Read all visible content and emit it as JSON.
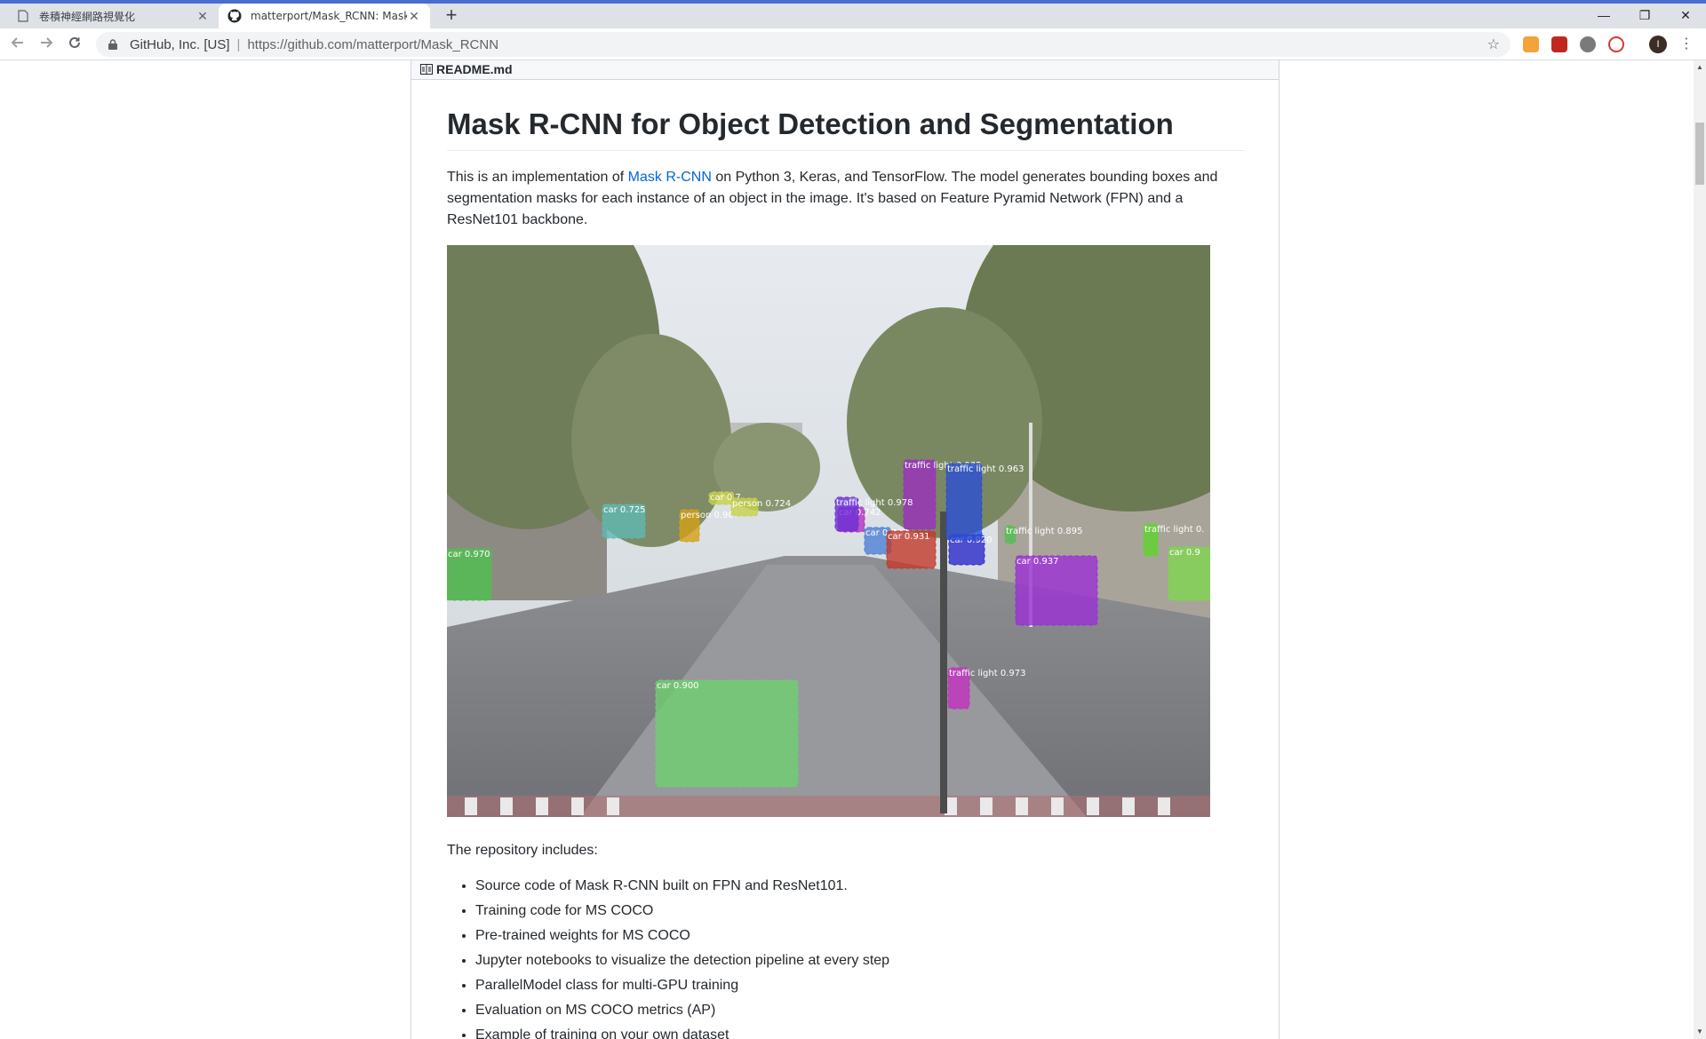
{
  "browser": {
    "tabs": [
      {
        "title": "卷積神經網路視覺化",
        "close": "✕"
      },
      {
        "title": "matterport/Mask_RCNN: Mask",
        "close": "✕"
      }
    ],
    "new_tab": "+",
    "window_controls": {
      "minimize": "—",
      "restore": "❐",
      "close": "✕"
    },
    "site_identity": "GitHub, Inc. [US]",
    "url": "https://github.com/matterport/Mask_RCNN",
    "profile_initial": "I",
    "extensions": [
      "#f2a33a",
      "#c0281f",
      "#7a7a7a",
      "#d23b2f"
    ]
  },
  "readme": {
    "file_label": "README.md",
    "title": "Mask R-CNN for Object Detection and Segmentation",
    "intro_pre": "This is an implementation of ",
    "intro_link": "Mask R-CNN",
    "intro_post": " on Python 3, Keras, and TensorFlow. The model generates bounding boxes and segmentation masks for each instance of an object in the image. It's based on Feature Pyramid Network (FPN) and a ResNet101 backbone.",
    "includes_intro": "The repository includes:",
    "features": [
      "Source code of Mask R-CNN built on FPN and ResNet101.",
      "Training code for MS COCO",
      "Pre-trained weights for MS COCO",
      "Jupyter notebooks to visualize the detection pipeline at every step",
      "ParallelModel class for multi-GPU training",
      "Evaluation on MS COCO metrics (AP)",
      "Example of training on your own dataset"
    ],
    "detections": [
      {
        "label": "car 0.970",
        "color": "#4fc14f"
      },
      {
        "label": "car 0.725",
        "color": "#5fb8b3"
      },
      {
        "label": "person 0.967",
        "color": "#d4a017"
      },
      {
        "label": "car 0.7",
        "color": "#c8d24a"
      },
      {
        "label": "person 0.724",
        "color": "#c8d24a"
      },
      {
        "label": "car 0.742",
        "color": "#b52fbf"
      },
      {
        "label": "car 0.860",
        "color": "#4f7fd4"
      },
      {
        "label": "car 0.931",
        "color": "#c33a2a"
      },
      {
        "label": "car 0.920",
        "color": "#2a2ac8"
      },
      {
        "label": "car 0.937",
        "color": "#9b2fd4"
      },
      {
        "label": "car 0.900",
        "color": "#6fcf6f"
      },
      {
        "label": "car 0.9",
        "color": "#7fd44f"
      },
      {
        "label": "traffic light 0.985",
        "color": "#9b2fbf"
      },
      {
        "label": "traffic light 0.963",
        "color": "#2a4fd4"
      },
      {
        "label": "traffic light 0.978",
        "color": "#6a2fd4"
      },
      {
        "label": "traffic light 0.895",
        "color": "#4fc14f"
      },
      {
        "label": "traffic light 0.",
        "color": "#5fd42a"
      },
      {
        "label": "traffic light 0.973",
        "color": "#c32fbf"
      }
    ]
  }
}
